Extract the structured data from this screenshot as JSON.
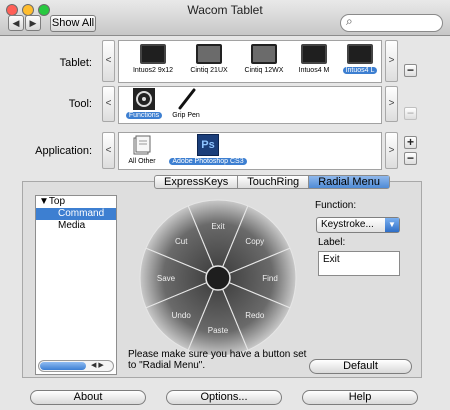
{
  "window": {
    "title": "Wacom Tablet"
  },
  "toolbar": {
    "show_all": "Show All",
    "search_placeholder": "",
    "back_glyph": "◀",
    "forward_glyph": "▶"
  },
  "rows": {
    "tablet_label": "Tablet:",
    "tool_label": "Tool:",
    "application_label": "Application:"
  },
  "tablets": [
    {
      "label": "Intuos2 9x12"
    },
    {
      "label": "Cintiq 21UX"
    },
    {
      "label": "Cintiq 12WX"
    },
    {
      "label": "Intuos4 M"
    },
    {
      "label": "Intuos4 L"
    }
  ],
  "tools": [
    {
      "label": "Functions"
    },
    {
      "label": "Grip Pen"
    }
  ],
  "applications": [
    {
      "label": "All Other"
    },
    {
      "label": "Adobe Photoshop CS3",
      "icon_text": "Ps"
    }
  ],
  "tabs": [
    {
      "label": "ExpressKeys"
    },
    {
      "label": "TouchRing"
    },
    {
      "label": "Radial Menu"
    }
  ],
  "tree": {
    "items": [
      "▼Top",
      "Command",
      "Media"
    ]
  },
  "wheel": {
    "labels": [
      "Exit",
      "Copy",
      "Find",
      "Redo",
      "Paste",
      "Undo",
      "Save",
      "Cut"
    ]
  },
  "function": {
    "label": "Function:",
    "value": "Keystroke...",
    "label_label": "Label:",
    "label_value": "Exit"
  },
  "note": "Please make sure you have a button set to \"Radial Menu\".",
  "buttons": {
    "default": "Default",
    "about": "About",
    "options": "Options...",
    "help": "Help"
  },
  "glyphs": {
    "left": "<",
    "right": ">",
    "plus": "+",
    "minus": "−",
    "search": "⌕"
  },
  "colors": {
    "selection": "#3d7fd1",
    "wheel_dark": "#2b2b2b"
  }
}
